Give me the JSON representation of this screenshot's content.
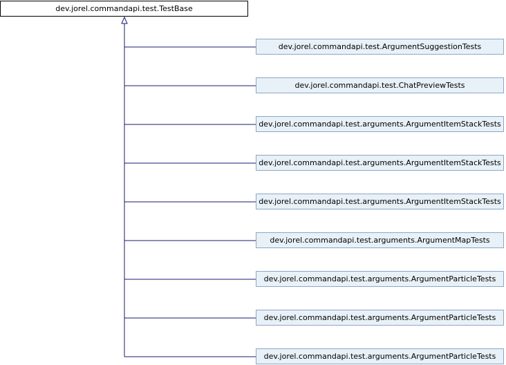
{
  "diagram": {
    "base_class": "dev.jorel.commandapi.test.TestBase",
    "subclasses": [
      "dev.jorel.commandapi.test.ArgumentSuggestionTests",
      "dev.jorel.commandapi.test.ChatPreviewTests",
      "dev.jorel.commandapi.test.arguments.ArgumentItemStackTests",
      "dev.jorel.commandapi.test.arguments.ArgumentItemStackTests",
      "dev.jorel.commandapi.test.arguments.ArgumentItemStackTests",
      "dev.jorel.commandapi.test.arguments.ArgumentMapTests",
      "dev.jorel.commandapi.test.arguments.ArgumentParticleTests",
      "dev.jorel.commandapi.test.arguments.ArgumentParticleTests",
      "dev.jorel.commandapi.test.arguments.ArgumentParticleTests"
    ],
    "colors": {
      "edge": "#191970",
      "base_border": "#000000",
      "child_border": "#8ba7c4",
      "child_fill": "#e8f1f8"
    }
  }
}
